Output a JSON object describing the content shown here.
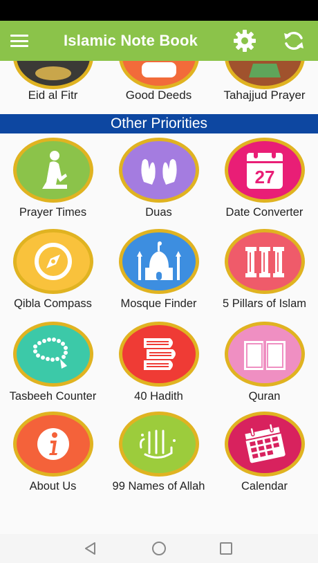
{
  "app_bar": {
    "title": "Islamic Note Book",
    "background": "#8bc34a"
  },
  "top_row": [
    {
      "label": "Eid al Fitr",
      "icon": "moon-lantern-icon",
      "color": "#3b3a36"
    },
    {
      "label": "Good Deeds",
      "icon": "hands-icon",
      "color": "#f26b3a"
    },
    {
      "label": "Tahajjud Prayer",
      "icon": "prayer-rug-icon",
      "color": "#a0522d"
    }
  ],
  "section": {
    "title": "Other Priorities",
    "background": "#0d47a1"
  },
  "tiles": [
    {
      "label": "Prayer Times",
      "icon": "praying-person-icon",
      "color": "#8bc34a"
    },
    {
      "label": "Duas",
      "icon": "praying-hands-icon",
      "color": "#a47ce0"
    },
    {
      "label": "Date Converter",
      "icon": "calendar-27-icon",
      "color": "#e91e76"
    },
    {
      "label": "Qibla Compass",
      "icon": "compass-icon",
      "color": "#f9c23c"
    },
    {
      "label": "Mosque Finder",
      "icon": "mosque-icon",
      "color": "#3d8ee0"
    },
    {
      "label": "5 Pillars of Islam",
      "icon": "pillars-icon",
      "color": "#ef5b6a"
    },
    {
      "label": "Tasbeeh Counter",
      "icon": "prayer-beads-icon",
      "color": "#3cc9a8"
    },
    {
      "label": "40 Hadith",
      "icon": "books-icon",
      "color": "#ef3b35"
    },
    {
      "label": "Quran",
      "icon": "open-book-icon",
      "color": "#ef8fc2"
    },
    {
      "label": "About Us",
      "icon": "info-icon",
      "color": "#f4623a"
    },
    {
      "label": "99 Names of Allah",
      "icon": "allah-calligraphy-icon",
      "color": "#9ccc3c"
    },
    {
      "label": "Calendar",
      "icon": "calendar-icon",
      "color": "#d8225e"
    }
  ],
  "ring_color": "#e0b321"
}
